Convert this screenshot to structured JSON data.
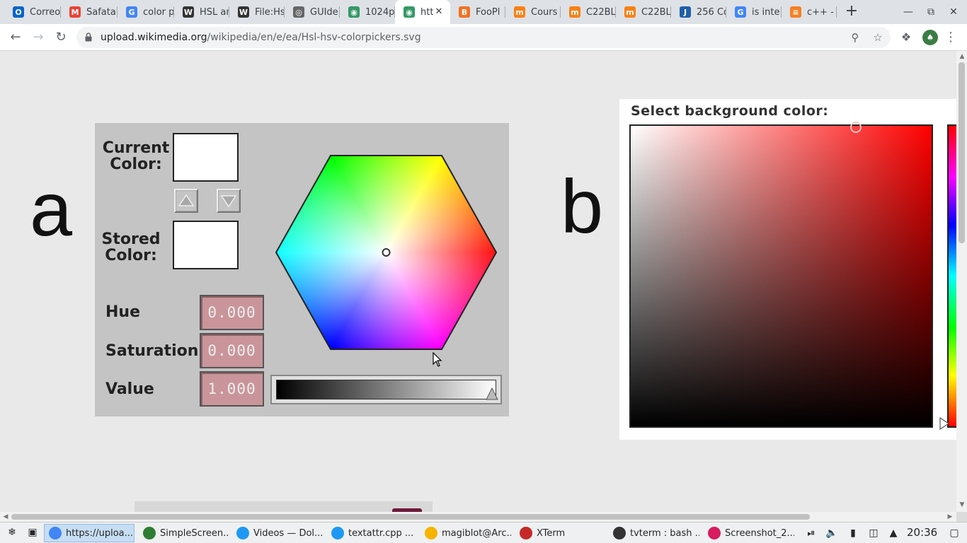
{
  "tabs": [
    {
      "label": "Correo",
      "icon": "outlook-icon",
      "color": "#0a64c8",
      "glyph": "O"
    },
    {
      "label": "Safata",
      "icon": "gmail-icon",
      "color": "#ea4335",
      "glyph": "M"
    },
    {
      "label": "color p",
      "icon": "google-icon",
      "color": "#4285f4",
      "glyph": "G"
    },
    {
      "label": "HSL an",
      "icon": "wikipedia-icon",
      "color": "#333333",
      "glyph": "W"
    },
    {
      "label": "File:Hs",
      "icon": "wikipedia-icon",
      "color": "#333333",
      "glyph": "W"
    },
    {
      "label": "GUIde",
      "icon": "globe-icon",
      "color": "#666666",
      "glyph": "◎"
    },
    {
      "label": "1024p",
      "icon": "wikimedia-icon",
      "color": "#339966",
      "glyph": "◉"
    },
    {
      "label": "htt",
      "icon": "wikimedia-icon",
      "color": "#339966",
      "glyph": "◉",
      "active": true
    },
    {
      "label": "FooPl",
      "icon": "foopl-icon",
      "color": "#f37021",
      "glyph": "B"
    },
    {
      "label": "Cours",
      "icon": "moodle-icon",
      "color": "#f98012",
      "glyph": "m"
    },
    {
      "label": "C22BL",
      "icon": "moodle-icon",
      "color": "#f98012",
      "glyph": "m"
    },
    {
      "label": "C22BL",
      "icon": "moodle-icon",
      "color": "#f98012",
      "glyph": "m"
    },
    {
      "label": "256 Co",
      "icon": "book-icon",
      "color": "#1f5fa8",
      "glyph": "J"
    },
    {
      "label": "is inte",
      "icon": "google-icon",
      "color": "#4285f4",
      "glyph": "G"
    },
    {
      "label": "c++ - F",
      "icon": "stackoverflow-icon",
      "color": "#f48024",
      "glyph": "≡"
    }
  ],
  "toolbar": {
    "url_host": "upload.wikimedia.org",
    "url_path": "/wikipedia/en/e/ea/Hsl-hsv-colorpickers.svg"
  },
  "image": {
    "label_a": "a",
    "label_b": "b",
    "panel_a": {
      "current_color_label": "Current\nColor:",
      "stored_color_label": "Stored\nColor:",
      "hue_label": "Hue",
      "hue_value": "0.000",
      "saturation_label": "Saturation",
      "saturation_value": "0.000",
      "value_label": "Value",
      "value_value": "1.000"
    },
    "panel_b": {
      "title": "Select background color:"
    }
  },
  "taskbar": {
    "items": [
      {
        "label": "https://uploa...",
        "icon": "chrome-icon",
        "color": "#4285f4",
        "active": true
      },
      {
        "label": "SimpleScreen...",
        "icon": "simplescreenrecorder-icon",
        "color": "#2e7d32"
      },
      {
        "label": "Videos — Dol...",
        "icon": "dolphin-icon",
        "color": "#1d99f3"
      },
      {
        "label": "textattr.cpp  ...",
        "icon": "kate-icon",
        "color": "#1d99f3"
      },
      {
        "label": "magiblot@Arc...",
        "icon": "konsole-icon",
        "color": "#f5b400"
      },
      {
        "label": "XTerm",
        "icon": "xterm-icon",
        "color": "#c62828"
      },
      {
        "label": "tvterm : bash ...",
        "icon": "terminal-icon",
        "color": "#333333"
      },
      {
        "label": "Screenshot_2...",
        "icon": "spectacle-icon",
        "color": "#d81b60"
      }
    ],
    "clock": "20:36"
  }
}
